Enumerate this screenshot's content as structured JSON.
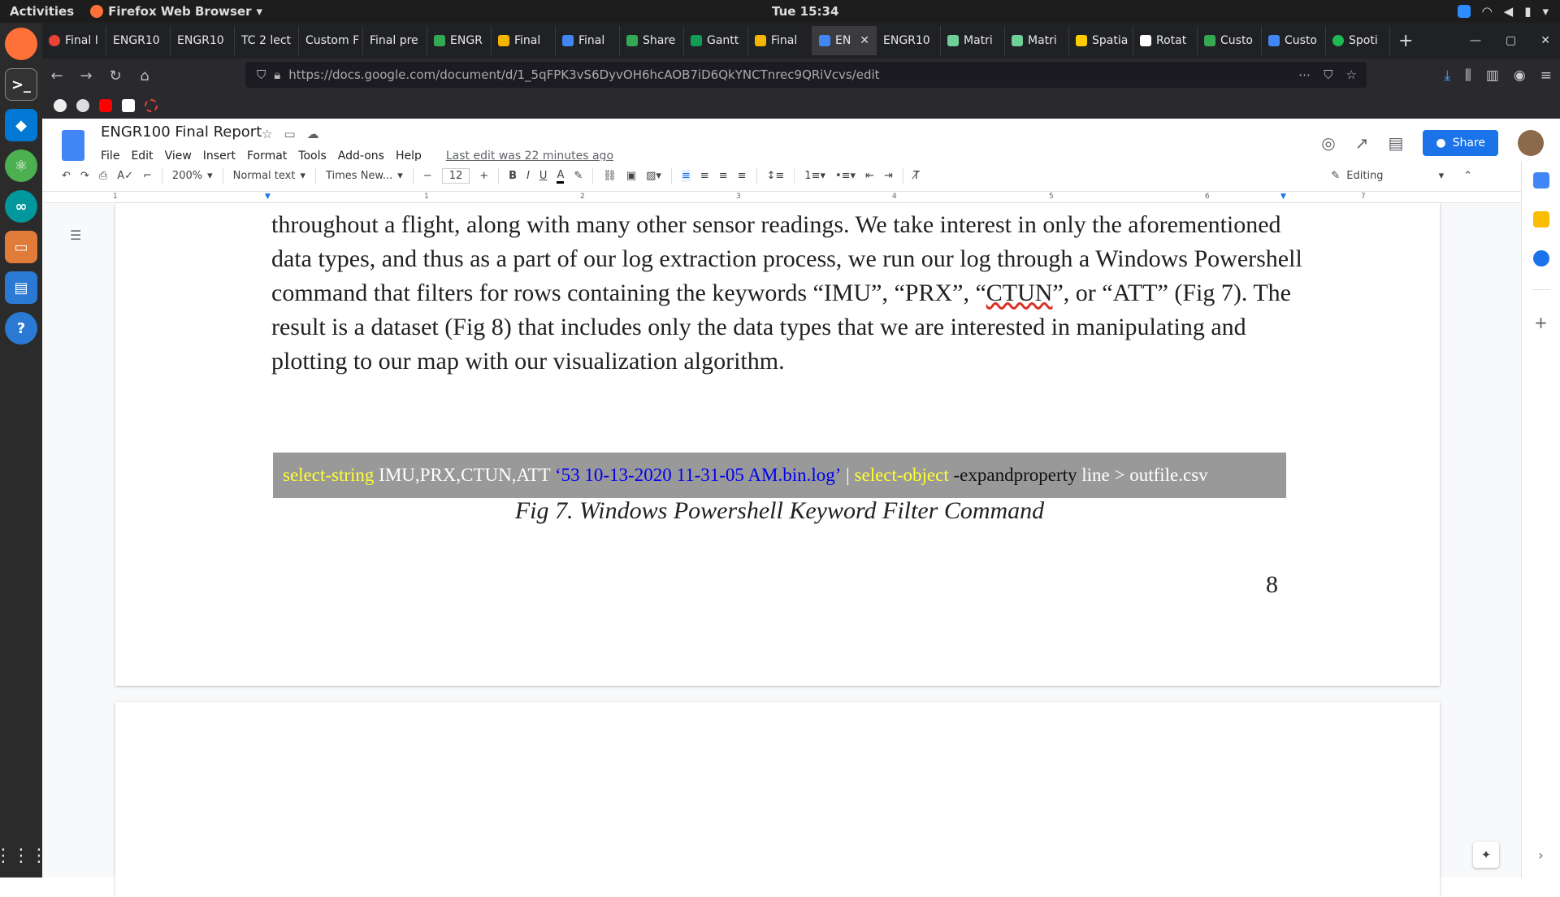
{
  "system": {
    "activities": "Activities",
    "browser_name": "Firefox Web Browser",
    "clock": "Tue 15:34"
  },
  "tabs": [
    {
      "label": "Final I",
      "icon": "red-circle-icon",
      "color": "#ea4335"
    },
    {
      "label": "ENGR10",
      "icon": "",
      "color": ""
    },
    {
      "label": "ENGR10",
      "icon": "",
      "color": ""
    },
    {
      "label": "TC 2 lect",
      "icon": "",
      "color": ""
    },
    {
      "label": "Custom F",
      "icon": "",
      "color": ""
    },
    {
      "label": "Final pre",
      "icon": "",
      "color": ""
    },
    {
      "label": "ENGR",
      "icon": "drive-icon",
      "color": "#34a853"
    },
    {
      "label": "Final",
      "icon": "slides-icon",
      "color": "#f4b400"
    },
    {
      "label": "Final",
      "icon": "docs-icon",
      "color": "#4285f4"
    },
    {
      "label": "Share",
      "icon": "drive-icon",
      "color": "#34a853"
    },
    {
      "label": "Gantt",
      "icon": "sheets-icon",
      "color": "#0f9d58"
    },
    {
      "label": "Final",
      "icon": "slides-icon",
      "color": "#f4b400"
    },
    {
      "label": "EN",
      "icon": "docs-icon",
      "color": "#4285f4",
      "active": true
    },
    {
      "label": "ENGR10",
      "icon": "",
      "color": ""
    },
    {
      "label": "Matri",
      "icon": "matlab-icon",
      "color": "#6fcf97"
    },
    {
      "label": "Matri",
      "icon": "matlab-icon",
      "color": "#6fcf97"
    },
    {
      "label": "Spatia",
      "icon": "cube-icon",
      "color": "#ffcc00"
    },
    {
      "label": "Rotat",
      "icon": "wikipedia-icon",
      "color": "#ffffff"
    },
    {
      "label": "Custo",
      "icon": "drive-icon",
      "color": "#34a853"
    },
    {
      "label": "Custo",
      "icon": "docs-icon",
      "color": "#4285f4"
    },
    {
      "label": "Spoti",
      "icon": "spotify-icon",
      "color": "#1db954"
    }
  ],
  "address": {
    "url": "https://docs.google.com/document/d/1_5qFPK3vS6DyvOH6hcAOB7iD6QkYNCTnrec9QRiVcvs/edit"
  },
  "docs": {
    "title": "ENGR100 Final Report",
    "menus": [
      "File",
      "Edit",
      "View",
      "Insert",
      "Format",
      "Tools",
      "Add-ons",
      "Help"
    ],
    "last_edit": "Last edit was 22 minutes ago",
    "share_label": "Share"
  },
  "toolbar": {
    "zoom": "200%",
    "style": "Normal text",
    "font": "Times New...",
    "font_size": "12",
    "mode": "Editing"
  },
  "ruler": [
    "1",
    "1",
    "2",
    "3",
    "4",
    "5",
    "6",
    "7"
  ],
  "body": {
    "paragraph_before_spell": "throughout a flight, along with many other sensor readings. We take interest in only the aforementioned data types, and thus as a part of our log extraction process, we run our log through a Windows Powershell command that filters for rows containing the keywords “IMU”, “PRX”, “",
    "spell_word": "CTUN",
    "paragraph_after_spell": "”, or “ATT” (Fig 7). The result is a dataset (Fig 8) that includes only the data types that we are interested in manipulating and plotting to our map with our visualization algorithm."
  },
  "code": {
    "cmd1": "select-string",
    "args": " IMU,PRX,CTUN,ATT ",
    "file": "‘53 10-13-2020 11-31-05 AM.bin.log’",
    "pipe": " | ",
    "cmd2": "select-object",
    "param": " -expandproperty",
    "rest": " line > outfile.csv"
  },
  "caption": "Fig 7. Windows Powershell Keyword Filter Command",
  "page_number": "8"
}
